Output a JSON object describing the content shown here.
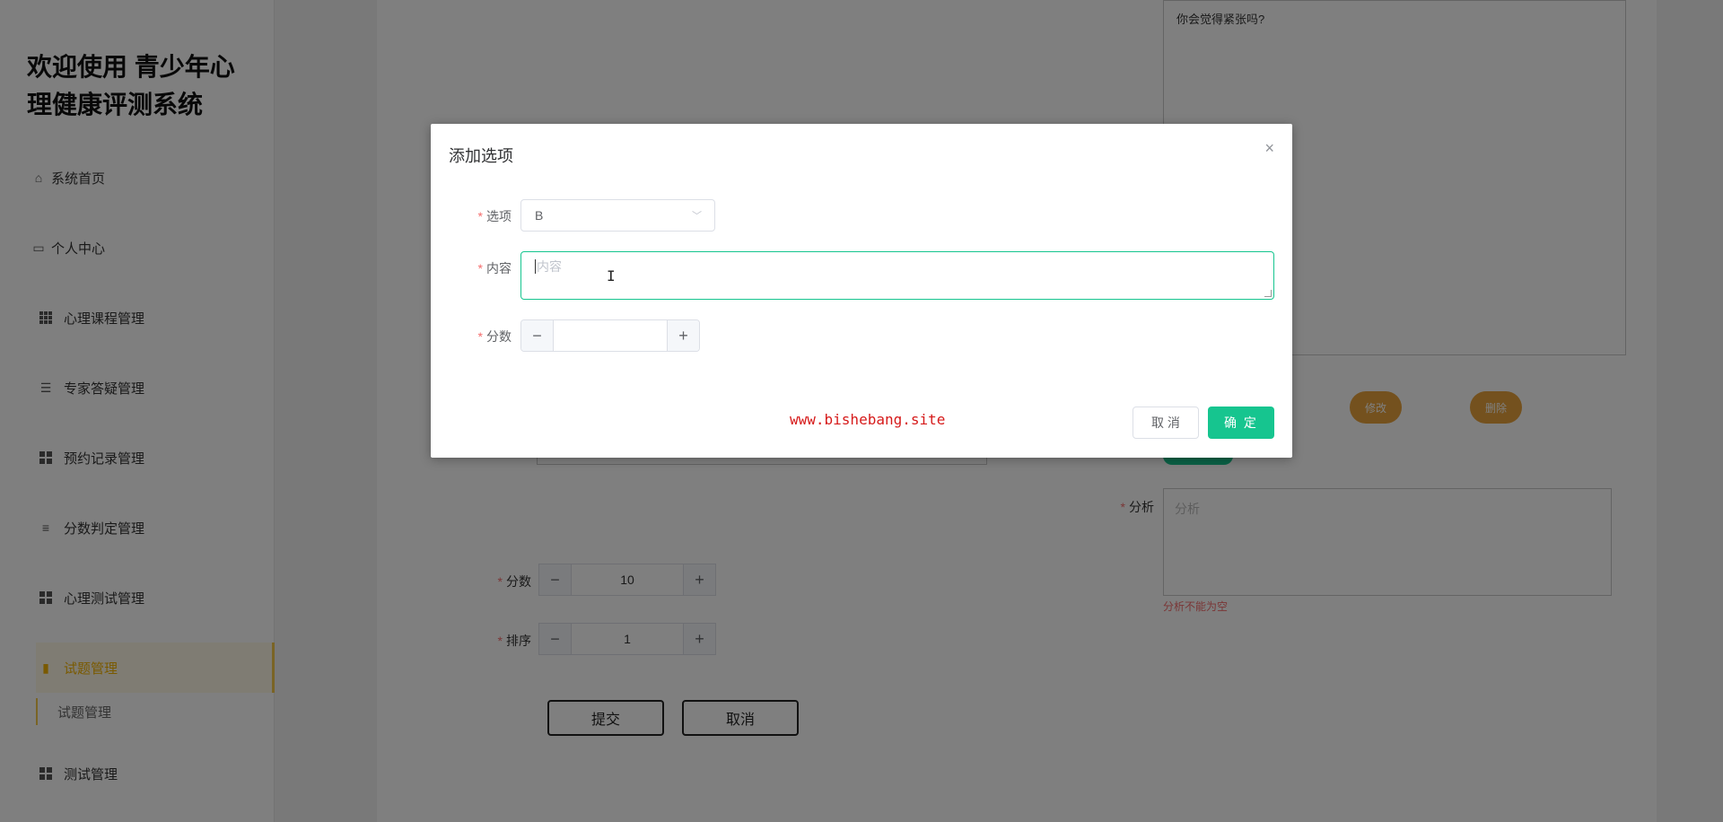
{
  "sidebar": {
    "brand": "欢迎使用 青少年心理健康评测系统",
    "items": [
      {
        "label": "系统首页",
        "icon": "home-icon"
      },
      {
        "label": "个人中心",
        "icon": "card-icon"
      },
      {
        "label": "心理课程管理",
        "icon": "grid-icon"
      },
      {
        "label": "专家答疑管理",
        "icon": "sliders-icon"
      },
      {
        "label": "预约记录管理",
        "icon": "grid-icon"
      },
      {
        "label": "分数判定管理",
        "icon": "list-icon"
      },
      {
        "label": "心理测试管理",
        "icon": "grid-icon"
      },
      {
        "label": "试题管理",
        "icon": "bar-chart-icon"
      },
      {
        "label": "测试管理",
        "icon": "grid-icon"
      }
    ],
    "submenu": {
      "label": "试题管理"
    }
  },
  "background_form": {
    "question_text": "你会觉得紧张吗?",
    "edit_label": "修改",
    "delete_label": "删除",
    "analysis_label": "分析",
    "analysis_placeholder": "分析",
    "analysis_error": "分析不能为空",
    "score_label": "分数",
    "score_value": "10",
    "sort_label": "排序",
    "sort_value": "1",
    "submit_label": "提交",
    "cancel_label": "取消",
    "minus": "−",
    "plus": "+"
  },
  "dialog": {
    "title": "添加选项",
    "close": "×",
    "option_label": "选项",
    "option_value": "B",
    "content_label": "内容",
    "content_placeholder": "内容",
    "score_label": "分数",
    "score_value": "",
    "cancel_label": "取 消",
    "ok_label": "确 定",
    "minus": "−",
    "plus": "+"
  },
  "watermark": "www.bishebang.site",
  "colors": {
    "accent": "#16c58f",
    "active": "#f5b400",
    "pill": "#e8a33c",
    "error": "#f56c6c"
  }
}
